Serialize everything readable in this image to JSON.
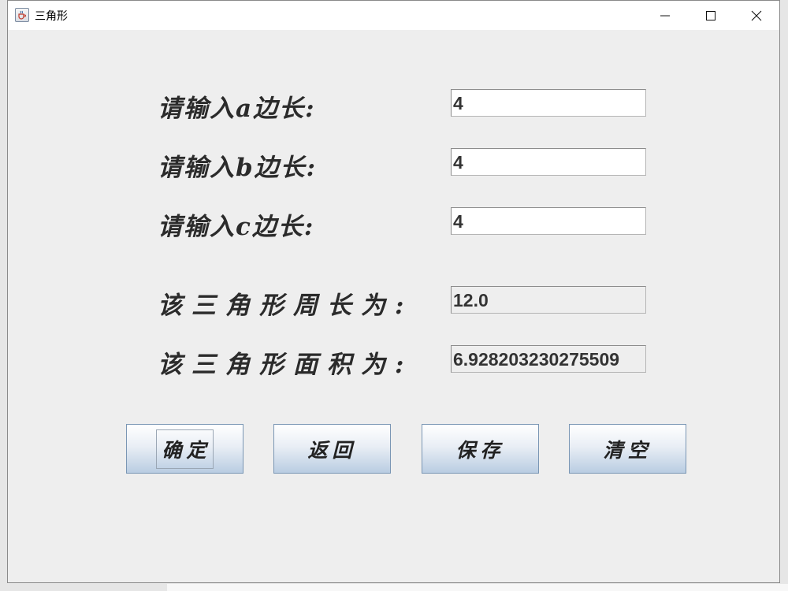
{
  "window": {
    "title": "三角形",
    "icons": {
      "app": "java-cup-icon",
      "minimize": "minimize-icon",
      "maximize": "maximize-icon",
      "close": "close-icon"
    }
  },
  "form": {
    "side_a_label": "请输入a边长:",
    "side_a_value": "4",
    "side_b_label": "请输入b边长:",
    "side_b_value": "4",
    "side_c_label": "请输入c边长:",
    "side_c_value": "4",
    "perimeter_label": "该三角形周长为:",
    "perimeter_value": "12.0",
    "area_label": "该三角形面积为:",
    "area_value": "6.928203230275509"
  },
  "buttons": {
    "confirm": "确定",
    "back": "返回",
    "save": "保存",
    "clear": "清空"
  },
  "colors": {
    "button_border": "#7a96b4",
    "button_gradient_bottom": "#b9cde2",
    "window_bg": "#eeeeee"
  }
}
